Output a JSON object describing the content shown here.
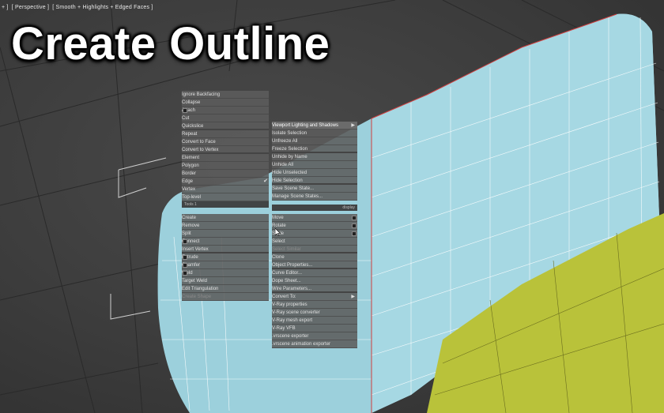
{
  "viewport": {
    "label": [
      "+ ]",
      "[ Perspective ]",
      "[ Smooth + Highlights + Edged Faces ]"
    ],
    "colors": {
      "mesh_face": "#9cd0dc",
      "wire": "#ffffff",
      "yellow_object": "#b9c23a",
      "menu_bg": "#5c5c5c"
    }
  },
  "title": "Create Outline",
  "quad_left_top": [
    {
      "label": "Ignore Backfacing",
      "box": false
    },
    {
      "label": "Collapse",
      "box": false
    },
    {
      "label": "Attach",
      "box": true
    },
    {
      "label": "Cut",
      "box": false
    },
    {
      "label": "Quickslice",
      "box": false,
      "sep": true
    },
    {
      "label": "Repeat",
      "box": false
    },
    {
      "label": "Convert to Face",
      "box": false
    },
    {
      "label": "Convert to Vertex",
      "box": false,
      "sep": true
    },
    {
      "label": "Element",
      "box": false
    },
    {
      "label": "Polygon",
      "box": false
    },
    {
      "label": "Border",
      "box": false
    },
    {
      "label": "Edge",
      "box": false,
      "check": true
    },
    {
      "label": "Vertex",
      "box": false
    },
    {
      "label": "Top-level",
      "box": false
    }
  ],
  "quad_left_bottom": [
    {
      "label": "Create",
      "box": false
    },
    {
      "label": "Remove",
      "box": false
    },
    {
      "label": "Split",
      "box": false
    },
    {
      "label": "Connect",
      "box": true
    },
    {
      "label": "Insert Vertex",
      "box": false,
      "sep": true
    },
    {
      "label": "Extrude",
      "box": true
    },
    {
      "label": "Chamfer",
      "box": true
    },
    {
      "label": "Weld",
      "box": true
    },
    {
      "label": "Target Weld",
      "box": false
    },
    {
      "label": "Edit Triangulation",
      "box": false
    },
    {
      "label": "Create Shape",
      "box": false,
      "dim": true
    }
  ],
  "quad_right_top": [
    {
      "label": "Viewport Lighting and Shadows",
      "arrow": true,
      "hl": true
    },
    {
      "label": "Isolate Selection"
    },
    {
      "label": "Unfreeze All"
    },
    {
      "label": "Freeze Selection",
      "sep": true
    },
    {
      "label": "Unhide by Name"
    },
    {
      "label": "Unhide All"
    },
    {
      "label": "Hide Unselected"
    },
    {
      "label": "Hide Selection",
      "sep": true
    },
    {
      "label": "Save Scene State..."
    },
    {
      "label": "Manage Scene States..."
    }
  ],
  "quad_right_bottom": [
    {
      "label": "Move",
      "box": true
    },
    {
      "label": "Rotate",
      "box": true
    },
    {
      "label": "Scale",
      "box": true
    },
    {
      "label": "Select"
    },
    {
      "label": "Select Similar",
      "dim": true,
      "sep": true
    },
    {
      "label": "Clone"
    },
    {
      "label": "Object Properties...",
      "sep": true
    },
    {
      "label": "Curve Editor..."
    },
    {
      "label": "Dope Sheet..."
    },
    {
      "label": "Wire Parameters...",
      "sep": true
    },
    {
      "label": "Convert To:",
      "arrow": true
    },
    {
      "label": "V-Ray properties"
    },
    {
      "label": "V-Ray scene converter"
    },
    {
      "label": "V-Ray mesh export"
    },
    {
      "label": "V-Ray VFB"
    },
    {
      "label": ".vrscene exporter"
    },
    {
      "label": ".vrscene animation exporter"
    }
  ],
  "quad_titles": {
    "left": "Tools 1",
    "right": "display"
  }
}
